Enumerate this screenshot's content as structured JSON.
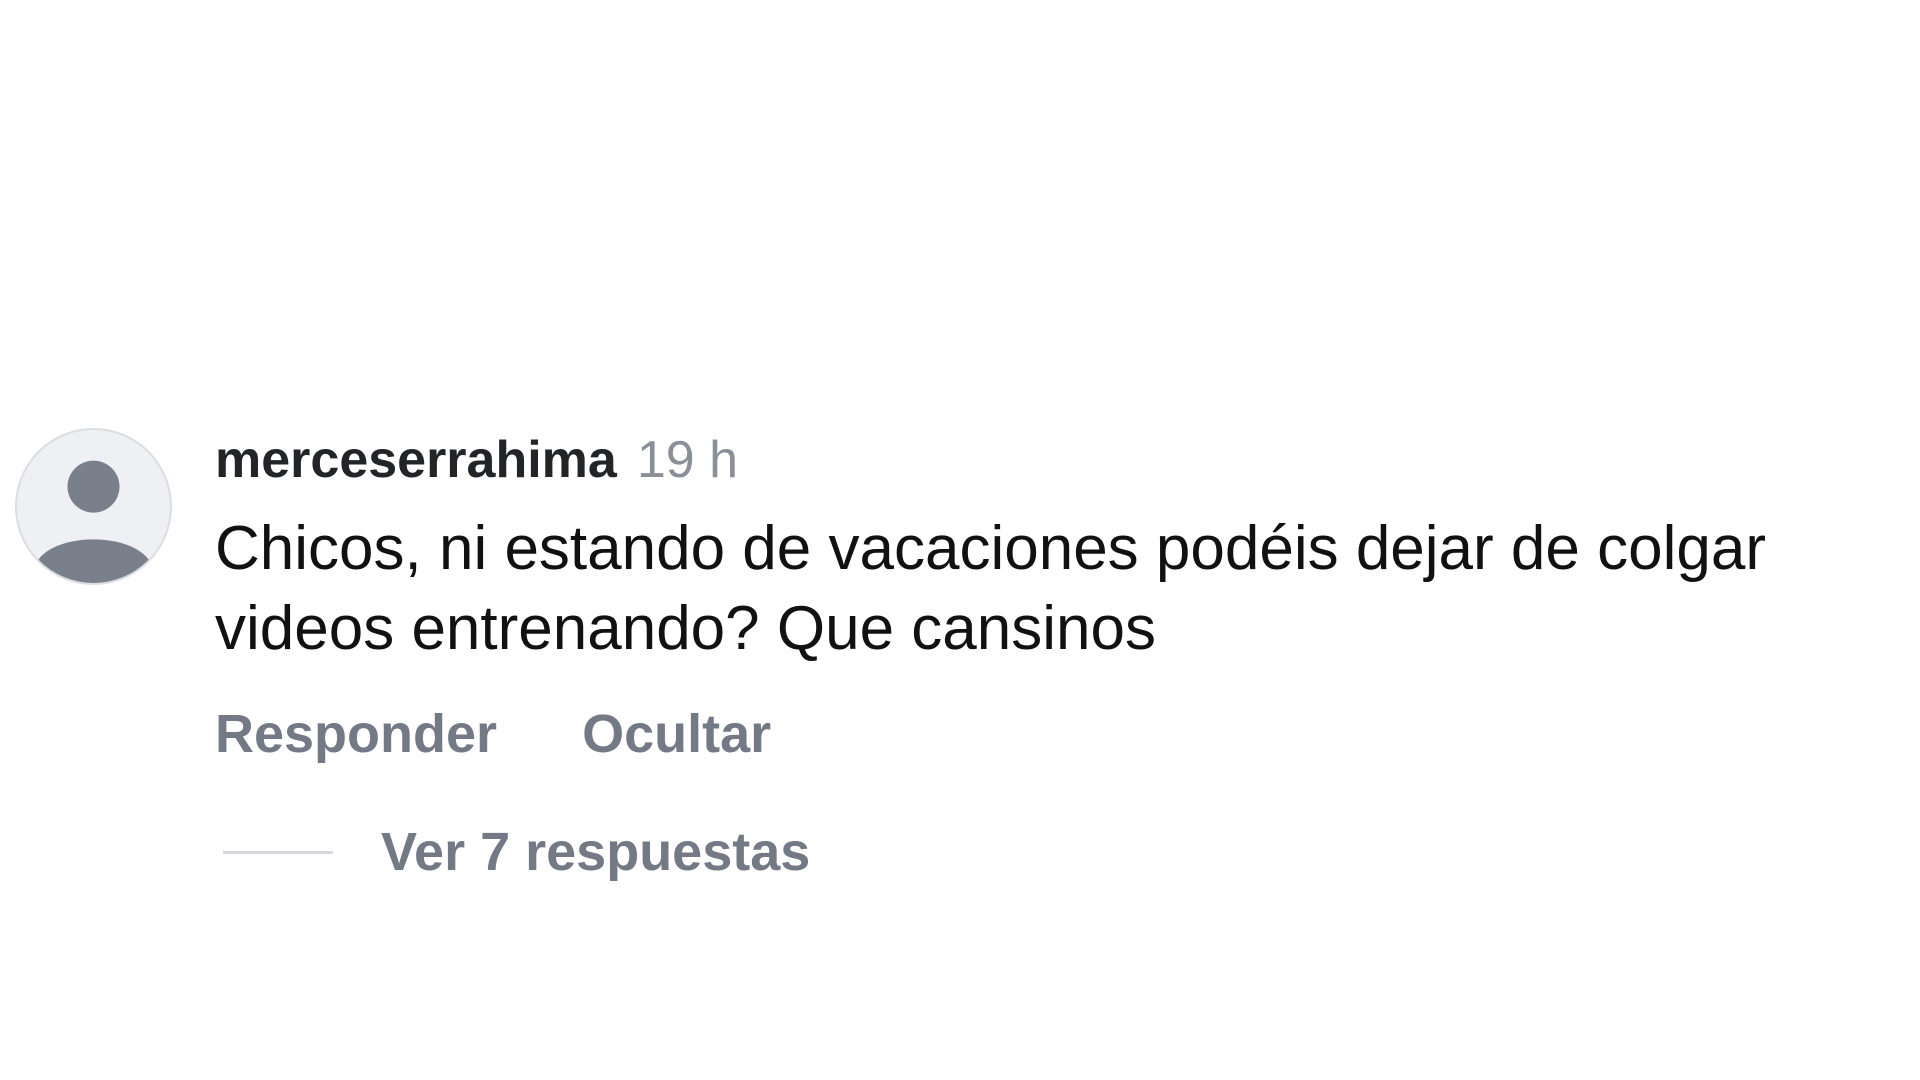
{
  "comment": {
    "avatar_icon": "default-user-avatar-icon",
    "username": "merceserrahima",
    "timestamp": "19 h",
    "text": "Chicos, ni estando de vacaciones podéis dejar de colgar videos entrenando? Que cansinos",
    "actions": {
      "reply_label": "Responder",
      "hide_label": "Ocultar"
    },
    "replies_label": "Ver 7 respuestas"
  },
  "colors": {
    "background": "#ffffff",
    "primary_text": "#111111",
    "secondary_text": "#737985",
    "avatar_bg": "#eff0f3",
    "avatar_figure": "#7a7f8c"
  }
}
